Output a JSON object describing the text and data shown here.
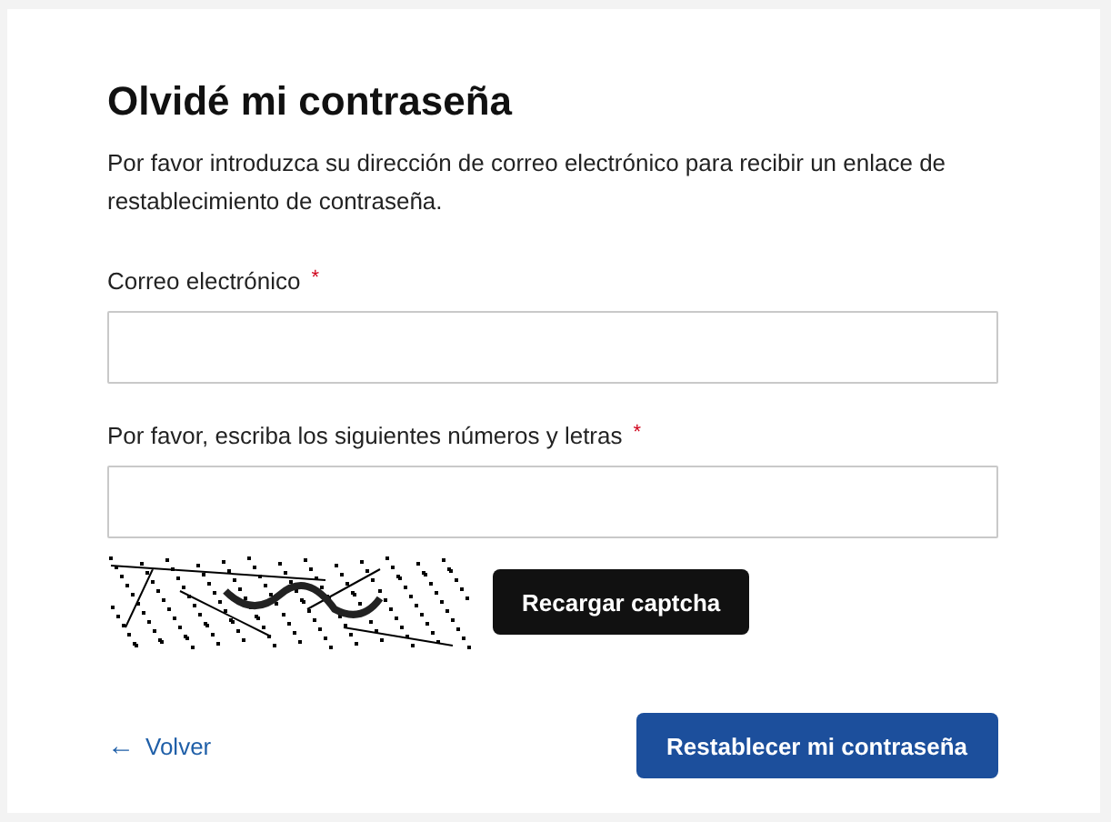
{
  "title": "Olvidé mi contraseña",
  "description": "Por favor introduzca su dirección de correo electrónico para recibir un enlace de restablecimiento de contraseña.",
  "fields": [
    {
      "label": "Correo electrónico",
      "required_mark": "*"
    },
    {
      "label": "Por favor, escriba los siguientes números y letras",
      "required_mark": "*"
    }
  ],
  "captcha": {
    "kind": "picture",
    "reload_button": "Recargar captcha"
  },
  "back_link": {
    "icon": "←",
    "label": "Volver"
  },
  "submit_button": "Restablecer mi contraseña"
}
